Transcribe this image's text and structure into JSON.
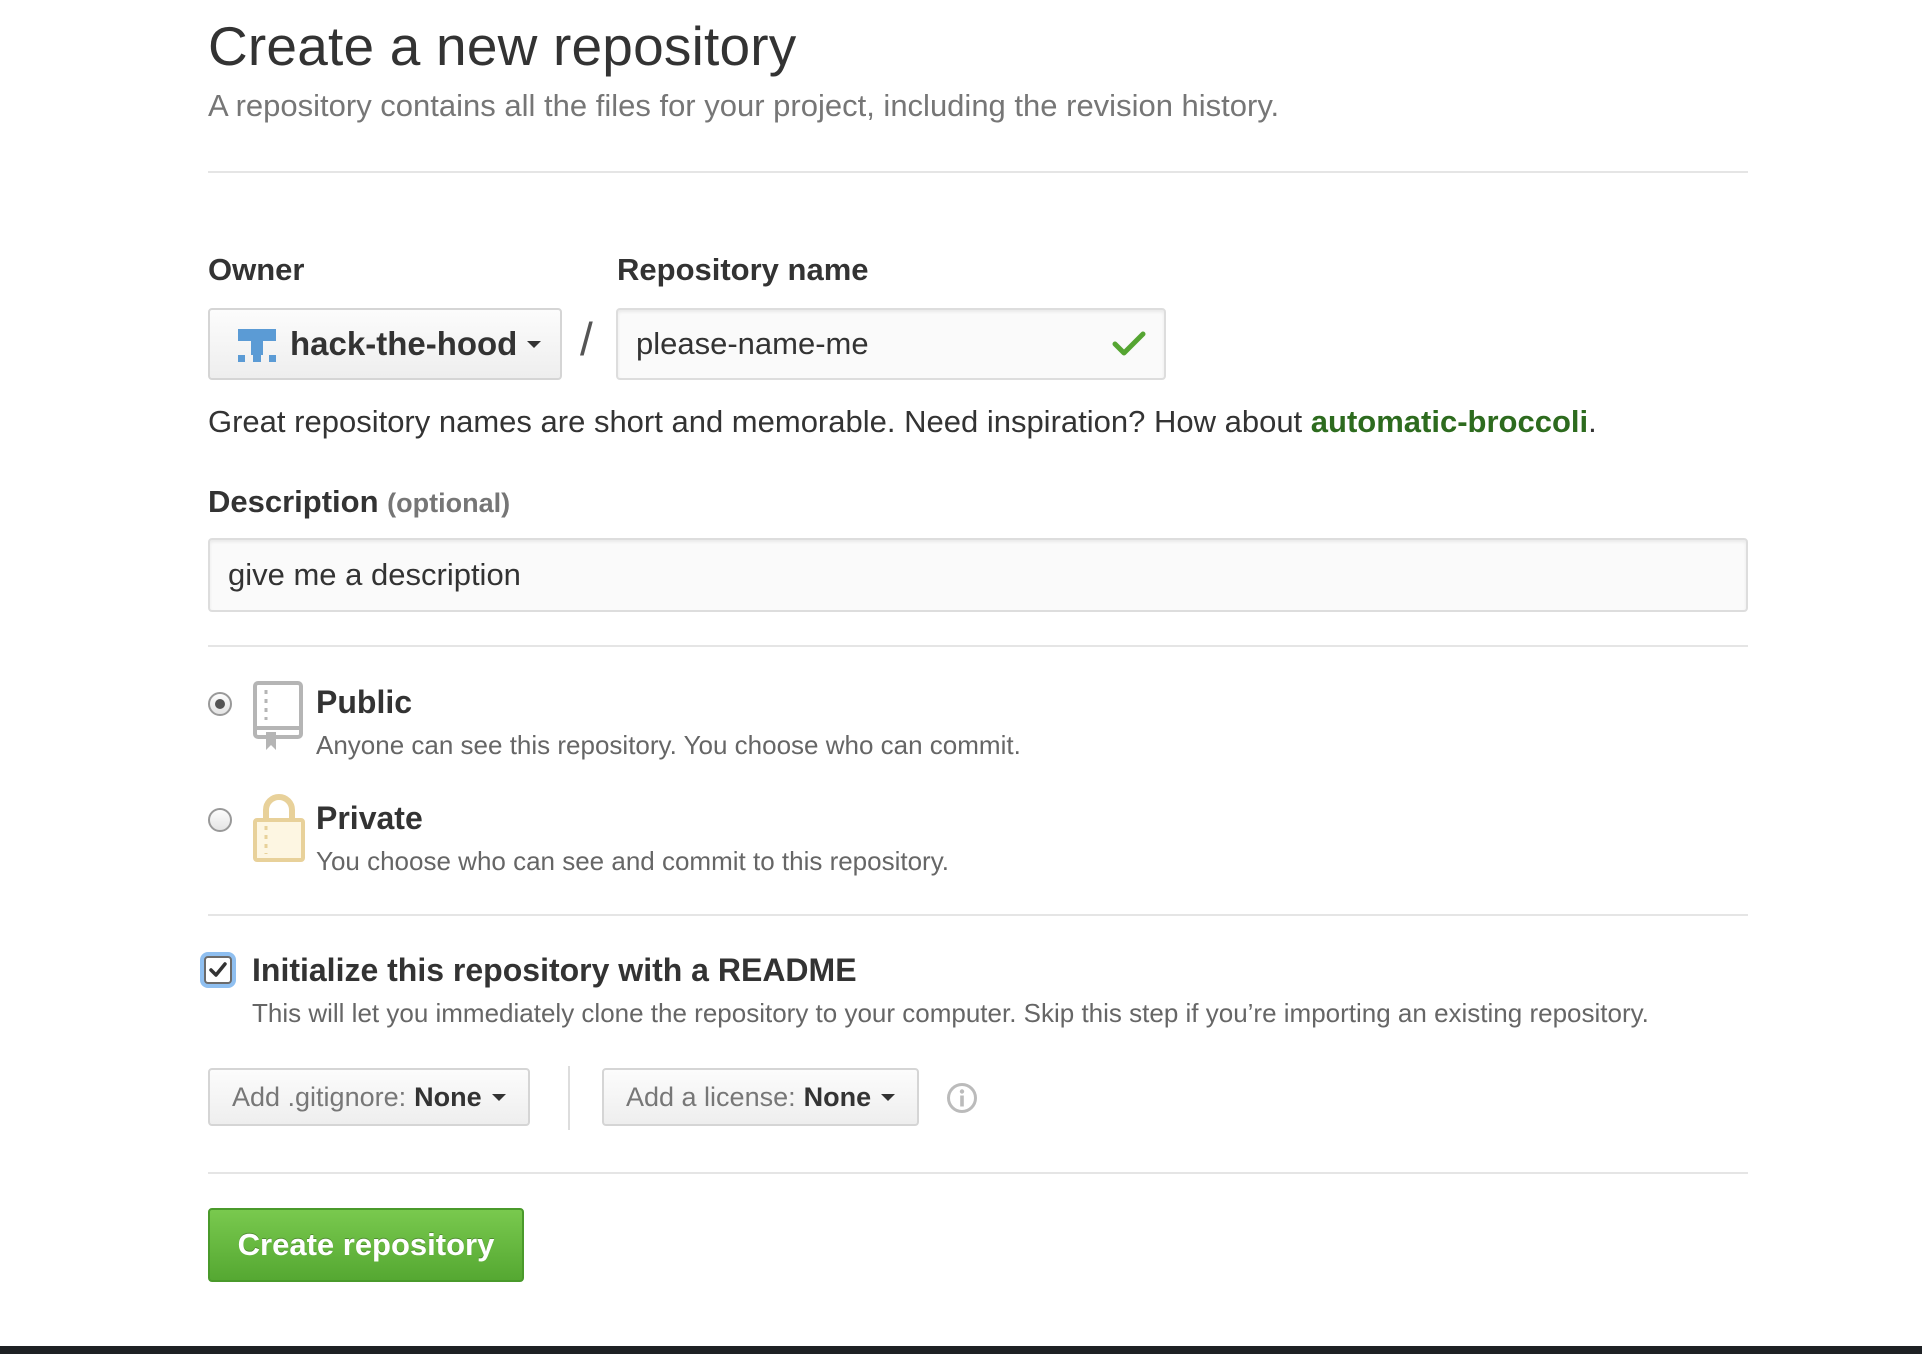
{
  "header": {
    "title": "Create a new repository",
    "subtitle": "A repository contains all the files for your project, including the revision history."
  },
  "owner": {
    "label": "Owner",
    "value": "hack-the-hood",
    "avatar_icon": "org-avatar-icon"
  },
  "separator": "/",
  "repo_name": {
    "label": "Repository name",
    "value": "please-name-me",
    "valid_icon": "checkmark-icon",
    "valid_color": "#55a532"
  },
  "name_hint": {
    "prefix": "Great repository names are short and memorable. Need inspiration? How about ",
    "suggestion": "automatic-broccoli",
    "suffix": "."
  },
  "description": {
    "label": "Description",
    "optional": "(optional)",
    "value": "give me a description"
  },
  "visibility": {
    "selected": "public",
    "public": {
      "title": "Public",
      "desc": "Anyone can see this repository. You choose who can commit.",
      "icon": "repo-book-icon"
    },
    "private": {
      "title": "Private",
      "desc": "You choose who can see and commit to this repository.",
      "icon": "lock-icon"
    }
  },
  "readme": {
    "checked": true,
    "title": "Initialize this repository with a README",
    "desc": "This will let you immediately clone the repository to your computer. Skip this step if you’re importing an existing repository."
  },
  "gitignore": {
    "label": "Add .gitignore:",
    "value": "None"
  },
  "license": {
    "label": "Add a license:",
    "value": "None",
    "info_icon": "info-icon"
  },
  "submit": {
    "label": "Create repository",
    "color": "#5cb85c"
  }
}
